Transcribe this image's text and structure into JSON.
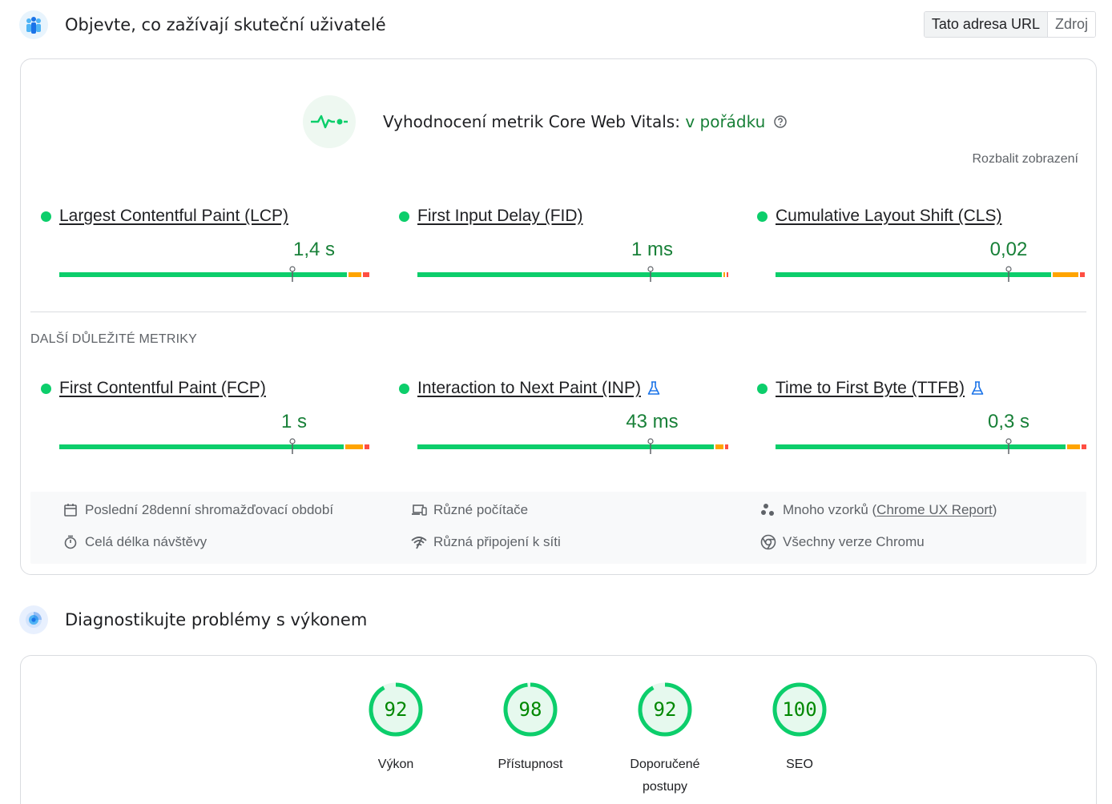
{
  "header1": {
    "title": "Objevte, co zažívají skuteční uživatelé"
  },
  "toggle": {
    "url_label": "Tato adresa URL",
    "origin_label": "Zdroj"
  },
  "cwv": {
    "label": "Vyhodnocení metrik Core Web Vitals:",
    "status": "v pořádku",
    "expand": "Rozbalit zobrazení"
  },
  "core_metrics": [
    {
      "name": "Largest Contentful Paint (LCP)",
      "value": "1,4 s"
    },
    {
      "name": "First Input Delay (FID)",
      "value": "1 ms"
    },
    {
      "name": "Cumulative Layout Shift (CLS)",
      "value": "0,02"
    }
  ],
  "other_heading": "DALŠÍ DŮLEŽITÉ METRIKY",
  "other_metrics": [
    {
      "name": "First Contentful Paint (FCP)",
      "value": "1 s"
    },
    {
      "name": "Interaction to Next Paint (INP)",
      "value": "43 ms"
    },
    {
      "name": "Time to First Byte (TTFB)",
      "value": "0,3 s"
    }
  ],
  "info": {
    "period": "Poslední 28denní shromažďovací období",
    "duration": "Celá délka návštěvy",
    "devices": "Různé počítače",
    "network": "Různá připojení k síti",
    "samples_prefix": "Mnoho vzorků (",
    "samples_link": "Chrome UX Report",
    "samples_suffix": ")",
    "chrome": "Všechny verze Chromu"
  },
  "header2": {
    "title": "Diagnostikujte problémy s výkonem"
  },
  "scores": [
    {
      "value": 92,
      "label": "Výkon"
    },
    {
      "value": 98,
      "label": "Přístupnost"
    },
    {
      "value": 92,
      "label": "Doporučené postupy"
    },
    {
      "value": 100,
      "label": "SEO"
    }
  ],
  "colors": {
    "good": "#0cce6b",
    "average": "#ffa400",
    "poor": "#ff4e42",
    "good_text": "#188038",
    "score_text": "#008800"
  }
}
